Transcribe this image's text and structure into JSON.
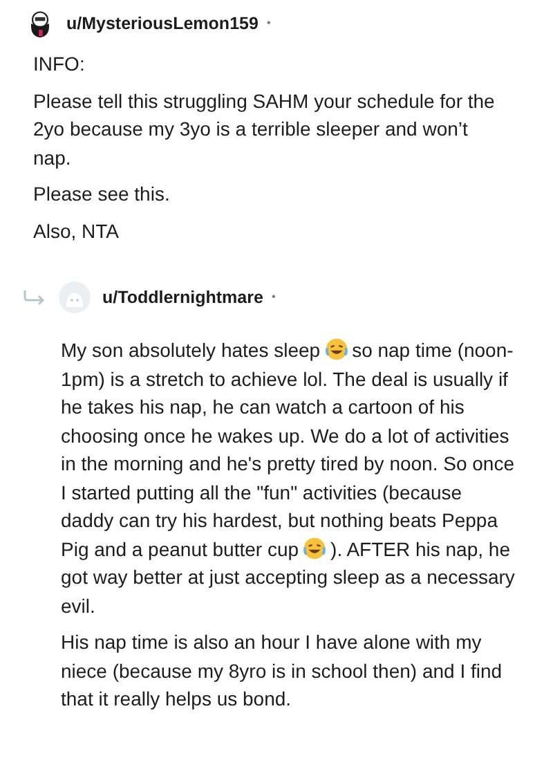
{
  "comments": [
    {
      "author": "u/MysteriousLemon159",
      "separator": "•",
      "reply": false,
      "avatar": {
        "kind": "character"
      },
      "paragraphs": [
        [
          {
            "kind": "text",
            "text": "INFO:"
          }
        ],
        [
          {
            "kind": "text",
            "text": "Please tell this struggling SAHM your schedule for the 2yo because my 3yo is a terrible sleeper and won’t nap."
          }
        ],
        [
          {
            "kind": "text",
            "text": "Please see this."
          }
        ],
        [
          {
            "kind": "text",
            "text": "Also, NTA"
          }
        ]
      ]
    },
    {
      "author": "u/Toddlernightmare",
      "separator": "•",
      "reply": true,
      "avatar": {
        "kind": "default"
      },
      "paragraphs": [
        [
          {
            "kind": "text",
            "text": "My son absolutely hates sleep"
          },
          {
            "kind": "emoji"
          },
          {
            "kind": "text",
            "text": "so nap time (noon-1pm) is a stretch to achieve lol. The deal is usually if he takes his nap, he can watch a cartoon of his choosing once he wakes up. We do a lot of activities in the morning and he's pretty tired by noon. So once I started putting all the \"fun\" activities (because daddy can try his hardest, but nothing beats Peppa Pig and a peanut butter cup"
          },
          {
            "kind": "emoji"
          },
          {
            "kind": "text",
            "text": "). AFTER his nap, he got way better at just accepting sleep as a necessary evil."
          }
        ],
        [
          {
            "kind": "text",
            "text": "His nap time is also an hour I have alone with my niece (because my 8yro is in school then) and I find that it really helps us bond."
          }
        ]
      ]
    }
  ]
}
